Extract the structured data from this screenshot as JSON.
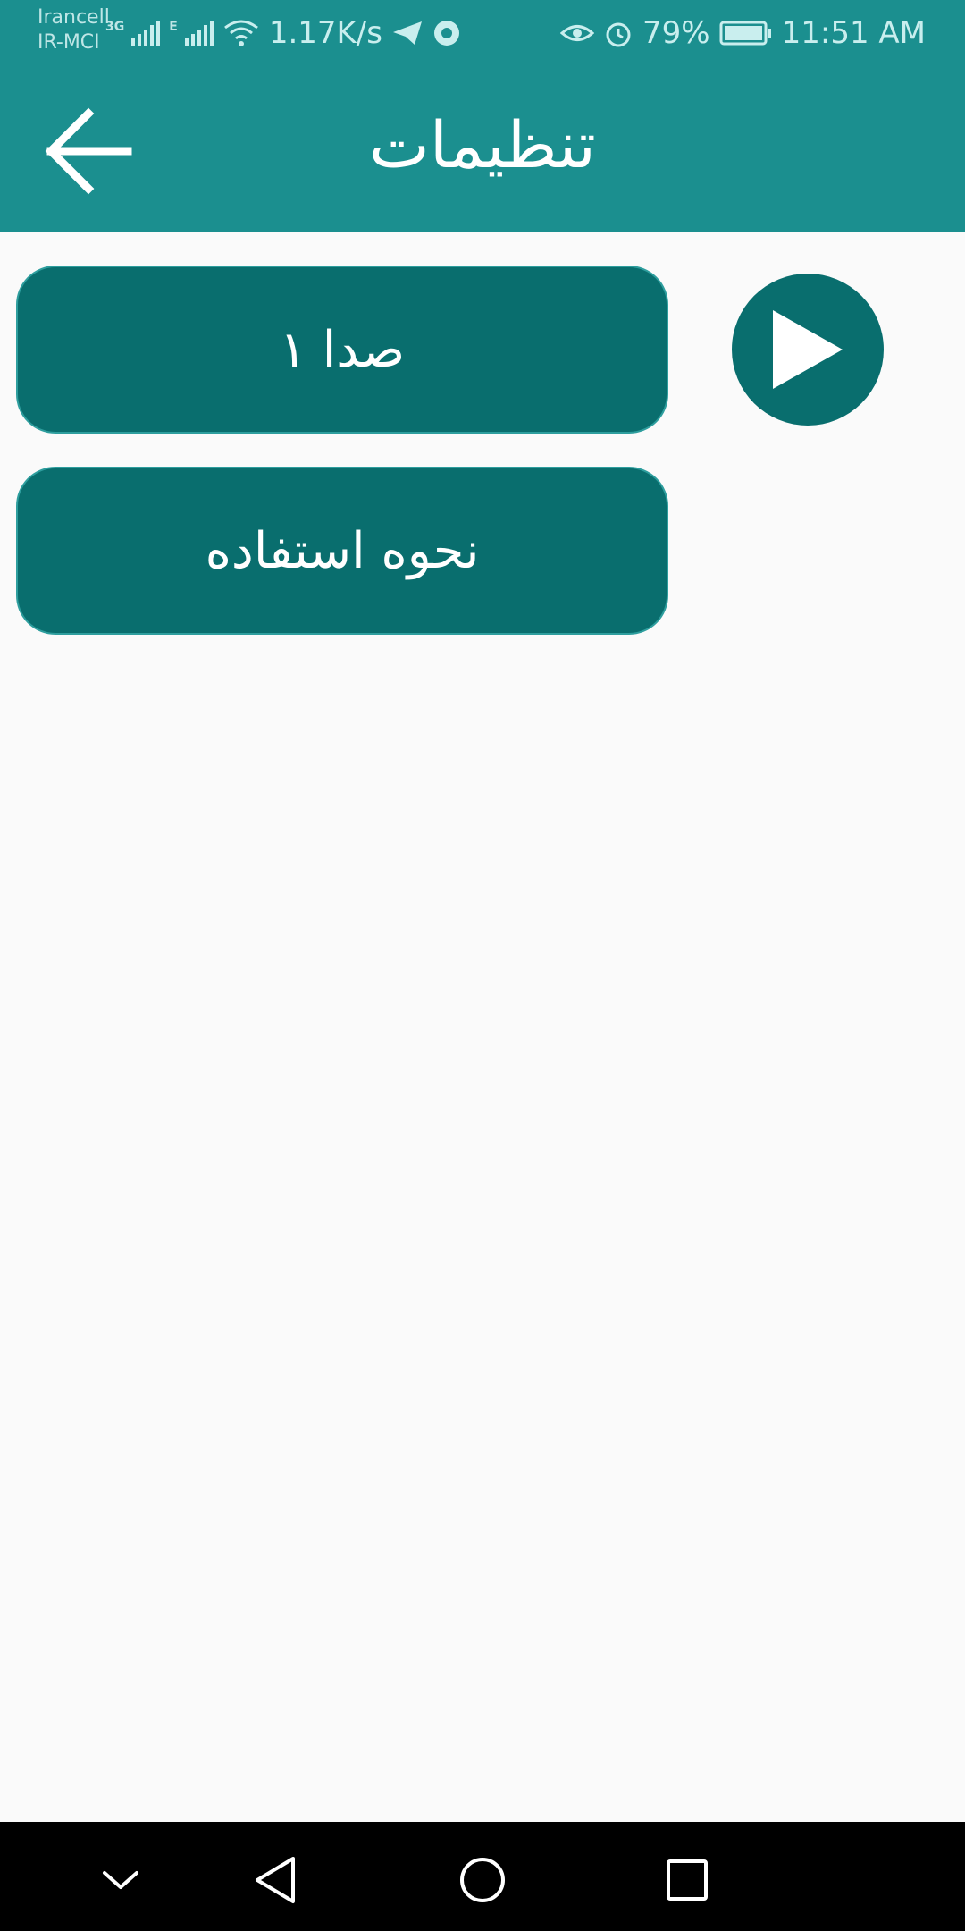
{
  "status_bar": {
    "carrier_1": "Irancell",
    "carrier_2": "IR-MCI",
    "network_1": "3G",
    "network_2": "E",
    "speed": "1.17K/s",
    "battery": "79%",
    "time": "11:51 AM",
    "icons": [
      "signal-icon",
      "wifi-icon",
      "telegram-icon",
      "chrome-icon",
      "eye-icon",
      "alarm-icon",
      "battery-icon"
    ]
  },
  "app_bar": {
    "title": "تنظیمات",
    "back_icon": "arrow-left-icon"
  },
  "buttons": {
    "sound": "صدا ۱",
    "how_to_use": "نحوه استفاده",
    "play_icon": "play-icon"
  },
  "nav_bar": {
    "icons": [
      "chevron-down-icon",
      "back-triangle-icon",
      "home-circle-icon",
      "recents-square-icon"
    ]
  },
  "colors": {
    "primary": "#1b8f8f",
    "button": "#096e6e",
    "background": "#fafafa"
  }
}
